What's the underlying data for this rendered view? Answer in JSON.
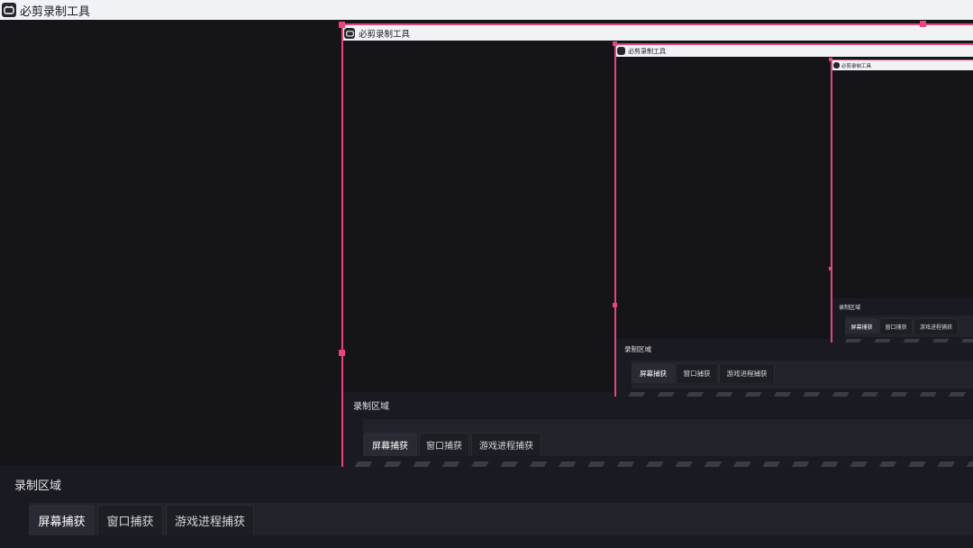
{
  "window": {
    "title": "必剪录制工具",
    "icon": "bijian-app-icon"
  },
  "panel": {
    "title": "录制区域",
    "tabs": [
      {
        "label": "屏幕捕获",
        "active": true
      },
      {
        "label": "窗口捕获",
        "active": false
      },
      {
        "label": "游戏进程捕获",
        "active": false
      }
    ]
  },
  "colors": {
    "selection_border": "#e7457e",
    "titlebar_bg": "#f1f2f6",
    "app_bg": "#121218",
    "panel_bg": "#1a1a22",
    "tab_active_bg": "#2a2a34"
  }
}
